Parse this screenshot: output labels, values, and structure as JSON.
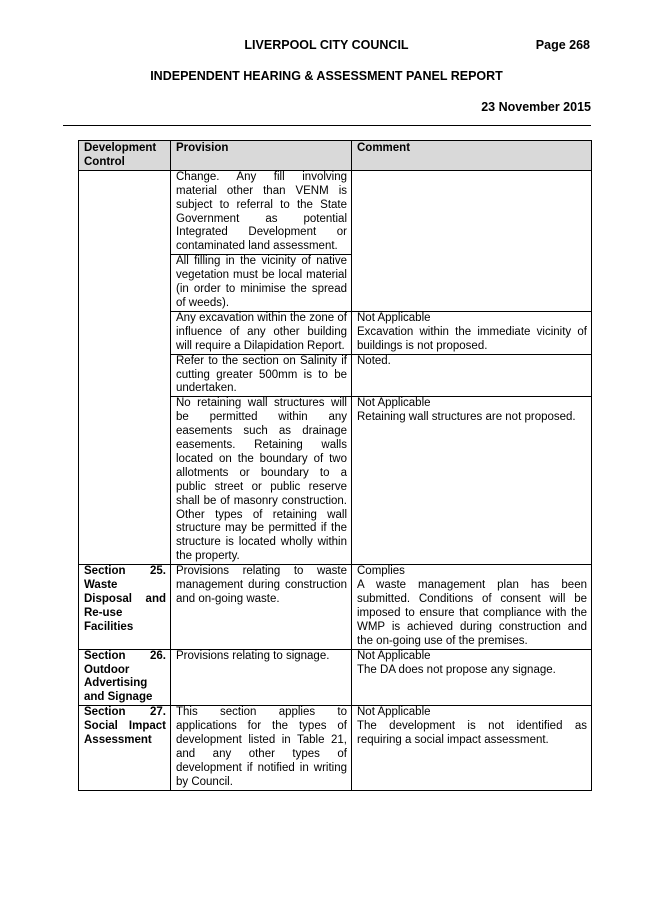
{
  "header": {
    "council": "LIVERPOOL CITY COUNCIL",
    "page": "Page 268",
    "report_title": "INDEPENDENT HEARING & ASSESSMENT PANEL REPORT",
    "date": "23 November 2015"
  },
  "table": {
    "columns": [
      "Development Control",
      "Provision",
      "Comment"
    ],
    "rows": [
      {
        "control": "",
        "provision": "Change. Any fill involving material other than VENM is subject to referral to the State Government as potential Integrated Development or contaminated land assessment.",
        "comment": ""
      },
      {
        "control": "",
        "provision": "All filling in the vicinity of native vegetation must be local material (in order to minimise the spread of weeds).",
        "comment": ""
      },
      {
        "control": "",
        "provision": "Any excavation within the zone of influence of any other building will require a Dilapidation Report.",
        "comment_status": "Not Applicable",
        "comment": "Excavation within the immediate vicinity of buildings is not proposed."
      },
      {
        "control": "",
        "provision": "Refer to the section on Salinity if cutting greater 500mm is to be undertaken.",
        "comment_status": "Noted.",
        "comment": ""
      },
      {
        "control": "",
        "provision": "No retaining wall structures will be permitted within any easements such as drainage easements. Retaining walls located on the boundary of two allotments or boundary to a public street or public reserve shall be of masonry construction. Other types of retaining wall structure may be permitted if the structure is located wholly within the property.",
        "comment_status": "Not Applicable",
        "comment": "Retaining wall structures are not proposed."
      },
      {
        "control": "Section 25. Waste Disposal and Re-use Facilities",
        "provision": "Provisions relating to waste management during construction and on-going waste.",
        "comment_status": "Complies",
        "comment": "A waste management plan has been submitted. Conditions of consent will be imposed to ensure that compliance with the WMP is achieved during construction and the on-going use of the premises."
      },
      {
        "control": "Section 26. Outdoor Advertising and Signage",
        "provision": "Provisions relating to signage.",
        "comment_status": "Not Applicable",
        "comment": "The DA does not propose any signage."
      },
      {
        "control": "Section 27. Social Impact Assessment",
        "provision": "This section applies to applications for the types of development listed in Table 21, and any other types of development if notified in writing by Council.",
        "comment_status": "Not Applicable",
        "comment": "The development is not identified as requiring a social impact assessment."
      }
    ]
  }
}
